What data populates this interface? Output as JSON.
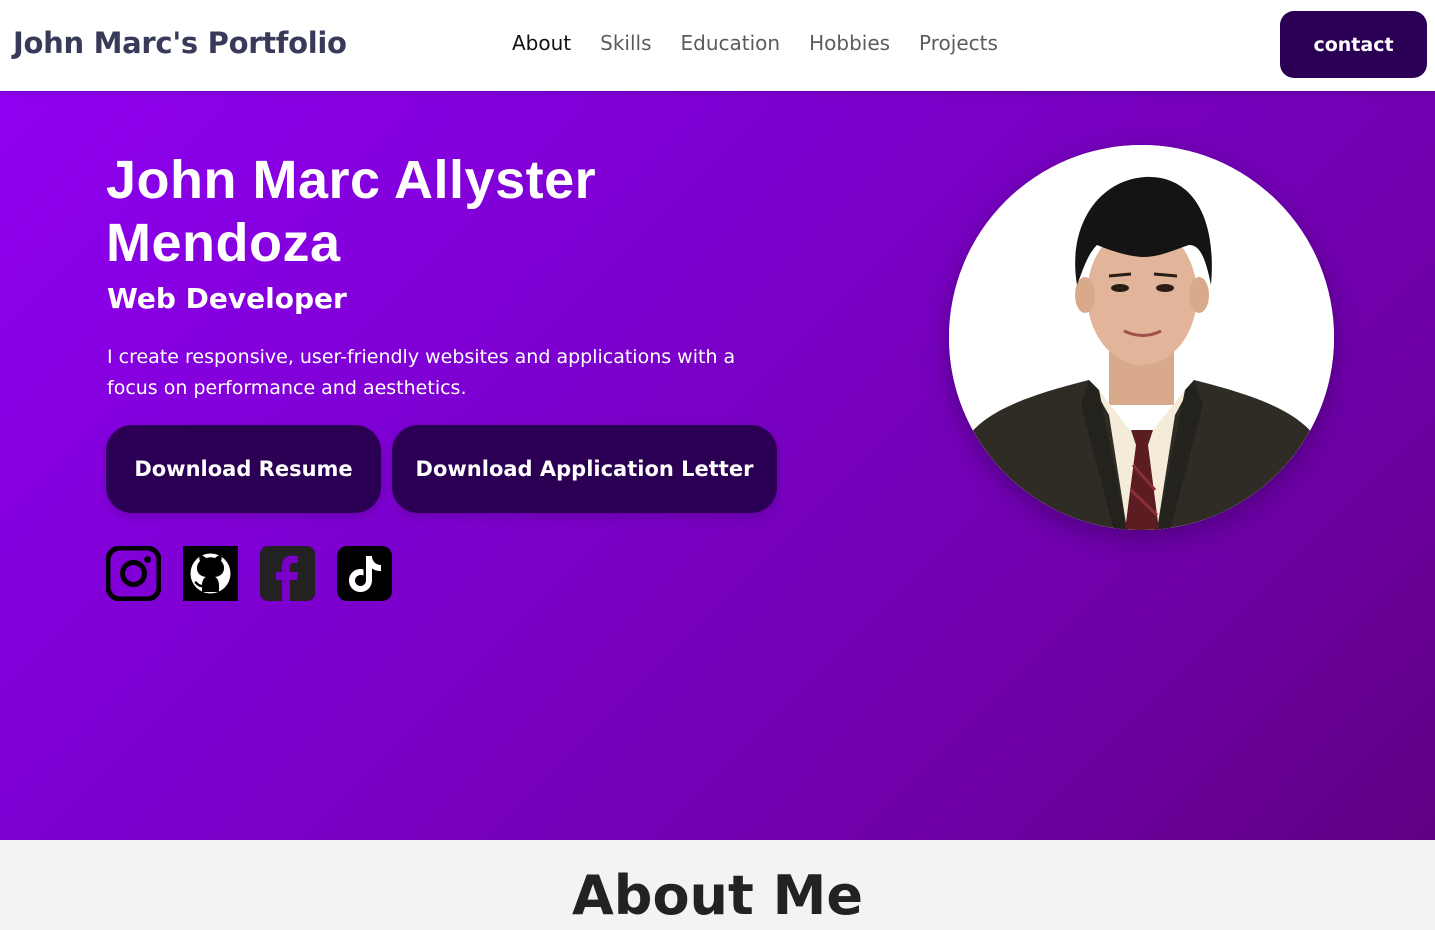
{
  "nav": {
    "brand": "John Marc's Portfolio",
    "links": [
      "About",
      "Skills",
      "Education",
      "Hobbies",
      "Projects"
    ],
    "active": "About",
    "contact_label": "contact"
  },
  "hero": {
    "name": "John Marc Allyster Mendoza",
    "role": "Web Developer",
    "description": "I create responsive, user-friendly websites and applications with a focus on performance and aesthetics.",
    "buttons": {
      "resume": "Download Resume",
      "letter": "Download Application Letter"
    },
    "socials": [
      "instagram-icon",
      "github-icon",
      "facebook-icon",
      "tiktok-icon"
    ]
  },
  "about": {
    "title": "About Me"
  },
  "colors": {
    "accent": "#2b0054",
    "hero_gradient_start": "#8f00f0",
    "hero_gradient_end": "#620083",
    "brand_text": "#383a5a"
  }
}
